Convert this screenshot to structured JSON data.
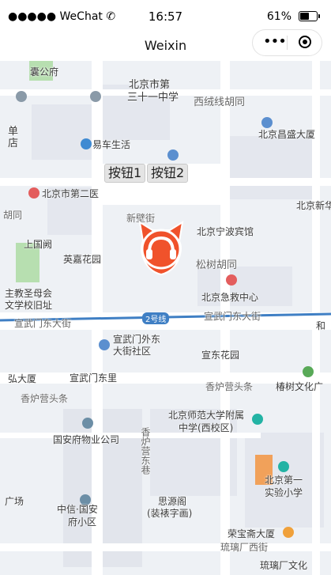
{
  "status_bar": {
    "signal": "●●●●● WeChat ✆",
    "time": "16:57",
    "battery": "61%",
    "battery_level": 0.61
  },
  "nav_bar": {
    "title": "Weixin"
  },
  "buttons": {
    "btn1": "按钮1",
    "btn2": "按钮2"
  },
  "map": {
    "labels": {
      "l1": "北京市第",
      "l2": "三十一中学",
      "l3": "西绒线胡同",
      "l4": "北京昌盛大厦",
      "l5": "易车生活",
      "l6": "北京市第二医",
      "l7": "北京新华",
      "l8": "新壁街",
      "l9": "北京宁波宾馆",
      "l10": "上国阙",
      "l11": "英嘉花园",
      "l12": "松树胡同",
      "l13": "北京急救中心",
      "l14": "宣武门东大街",
      "l15": "2号线",
      "l16": "宣武门外东",
      "l17": "大街社区",
      "l18": "宣东花园",
      "l19": "宣武门东里",
      "l20": "香炉营头条",
      "l21": "椿树文化广",
      "l22": "北京师范大学附属",
      "l23": "中学(西校区)",
      "l24": "国安府物业公司",
      "l25": "北京第一",
      "l26": "实验小学",
      "l27": "中信·国安",
      "l28": "府小区",
      "l29": "思源阁",
      "l30": "(装裱字画)",
      "l31": "荣宝斋大厦",
      "l32": "琉璃厂西街",
      "l33": "琉璃厂文化",
      "l34": "囊公府",
      "l35": "单",
      "l36": "店",
      "l37": "胡同",
      "l38": "主教圣母会",
      "l39": "文学校旧址",
      "l40": "弘大厦",
      "l41": "香炉营东巷",
      "l42": "香炉营头条",
      "l43": "广场",
      "l44": "宣武门东大街",
      "l45": "和"
    }
  },
  "colors": {
    "accent": "#f0522b",
    "road": "#ffffff",
    "block": "#e3e6ec"
  }
}
